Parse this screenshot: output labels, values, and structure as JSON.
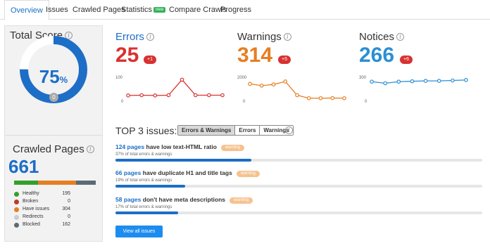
{
  "tabs": [
    {
      "label": "Overview",
      "active": true
    },
    {
      "label": "Issues"
    },
    {
      "label": "Crawled Pages"
    },
    {
      "label": "Statistics",
      "badge": "new"
    },
    {
      "label": "Compare Crawls"
    },
    {
      "label": "Progress"
    }
  ],
  "total_score": {
    "title": "Total Score",
    "value": "75",
    "unit": "%",
    "change": "0",
    "fraction": 0.75,
    "color": "#1d6ec6"
  },
  "crawled_pages": {
    "title": "Crawled Pages",
    "value": "661",
    "legend": [
      {
        "label": "Healthy",
        "value": "195",
        "color": "#33a02c",
        "n": 195
      },
      {
        "label": "Broken",
        "value": "0",
        "color": "#c0392b",
        "n": 0
      },
      {
        "label": "Have issues",
        "value": "304",
        "color": "#e67e22",
        "n": 304
      },
      {
        "label": "Redirects",
        "value": "0",
        "color": "#cccccc",
        "n": 0
      },
      {
        "label": "Blocked",
        "value": "162",
        "color": "#5b6b75",
        "n": 162
      }
    ]
  },
  "metrics": {
    "errors": {
      "title": "Errors",
      "value": "25",
      "badge": "+1",
      "color": "#d93131",
      "axis_top": "100",
      "axis_bottom": "0"
    },
    "warnings": {
      "title": "Warnings",
      "value": "314",
      "badge": "+5",
      "color": "#e67e22",
      "axis_top": "2000",
      "axis_bottom": "0"
    },
    "notices": {
      "title": "Notices",
      "value": "266",
      "badge": "+6",
      "color": "#2b8fd6",
      "axis_top": "300",
      "axis_bottom": "0"
    }
  },
  "chart_data": [
    {
      "type": "line",
      "series": [
        {
          "values": [
            24,
            25,
            24,
            25,
            90,
            25,
            25,
            25
          ]
        }
      ],
      "ylim": [
        0,
        100
      ],
      "yticks": [
        "100",
        "0"
      ]
    },
    {
      "type": "line",
      "series": [
        {
          "values": [
            1450,
            1300,
            1400,
            1650,
            500,
            250,
            250,
            260,
            250
          ]
        }
      ],
      "ylim": [
        0,
        2000
      ],
      "yticks": [
        "2000",
        "0"
      ]
    },
    {
      "type": "line",
      "series": [
        {
          "values": [
            245,
            225,
            245,
            250,
            255,
            255,
            260,
            266
          ]
        }
      ],
      "ylim": [
        0,
        300
      ],
      "yticks": [
        "300",
        "0"
      ]
    }
  ],
  "top_issues": {
    "title": "TOP 3 issues:",
    "filters": [
      "Errors & Warnings",
      "Errors",
      "Warnings"
    ],
    "items": [
      {
        "pages": "124 pages",
        "text": "have low text-HTML ratio",
        "badge": "warning",
        "sub": "37% of total errors & warnings",
        "percent": 37
      },
      {
        "pages": "66 pages",
        "text": "have duplicate H1 and title tags",
        "badge": "warning",
        "sub": "19% of total errors & warnings",
        "percent": 19
      },
      {
        "pages": "58 pages",
        "text": "don't have meta descriptions",
        "badge": "warning",
        "sub": "17% of total errors & warnings",
        "percent": 17
      }
    ],
    "button": "View all issues"
  }
}
